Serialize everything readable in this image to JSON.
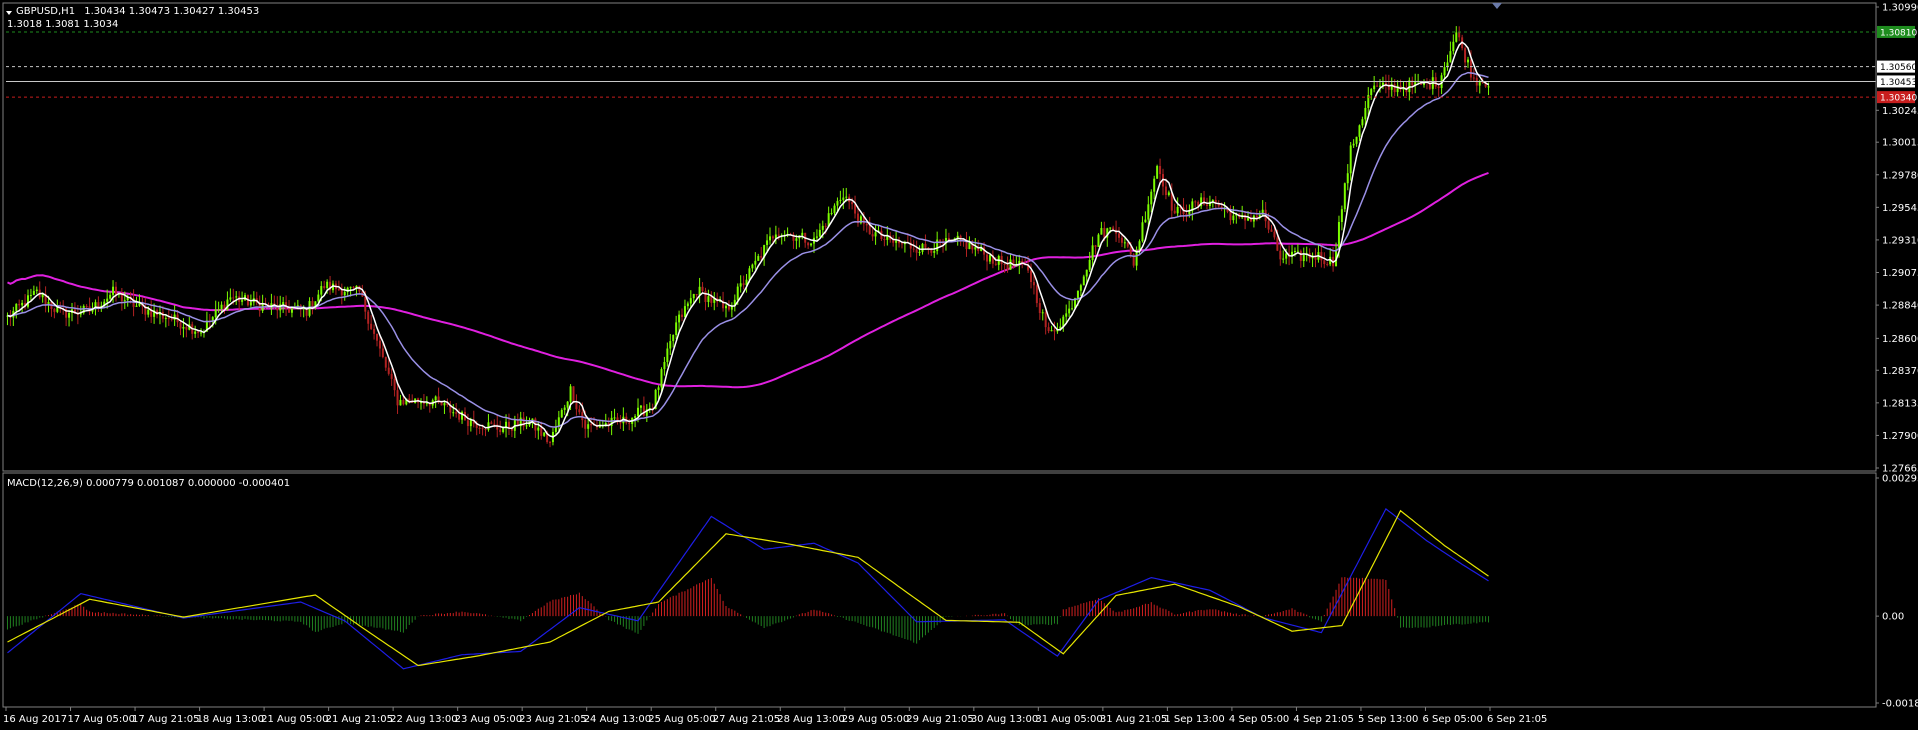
{
  "window": {
    "title": "GBPUSD,H1",
    "ohlc": "1.30434 1.30473 1.30427 1.30453",
    "levels_line": "1.3018 1.3081 1.3034"
  },
  "colors": {
    "background": "#000000",
    "frame": "#808080",
    "bull_candle": "#7CFC00",
    "bear_candle": "#B22222",
    "ma_fast": "#FFFFFF",
    "ma_mid": "#9A90E6",
    "ma_slow": "#E020E0",
    "macd_line": "#1E1EE6",
    "signal_line": "#E6E600",
    "hist_pos": "#D22020",
    "hist_neg": "#208020",
    "level_green": "#1E8C1E",
    "level_white": "#FFFFFF",
    "level_red": "#C81E1E"
  },
  "icons": {
    "menu_arrow": "triangle-down-icon",
    "shift_marker": "triangle-down-icon"
  },
  "price_axis": {
    "ticks": [
      "1.30990",
      "1.30560",
      "1.30453",
      "1.30245",
      "1.30015",
      "1.29780",
      "1.29545",
      "1.29310",
      "1.29075",
      "1.28840",
      "1.28600",
      "1.28370",
      "1.28135",
      "1.27900",
      "1.27665"
    ],
    "grid_ticks": [
      1.3099,
      1.30245,
      1.30015,
      1.2978,
      1.29545,
      1.2931,
      1.29075,
      1.2884,
      1.286,
      1.2837,
      1.28135,
      1.279,
      1.27665
    ],
    "range": [
      1.27665,
      1.3099
    ]
  },
  "price_tags": [
    {
      "label": "1.30810",
      "value": 1.3081,
      "color": "#1E8C1E",
      "text_color": "#FFFFFF",
      "line_style": "dashed"
    },
    {
      "label": "1.30560",
      "value": 1.3056,
      "color": "#FFFFFF",
      "text_color": "#000000",
      "line_style": "dashed"
    },
    {
      "label": "1.30453",
      "value": 1.30453,
      "color": "#FFFFFF",
      "text_color": "#000000",
      "line_style": "solid"
    },
    {
      "label": "1.30340",
      "value": 1.3034,
      "color": "#C81E1E",
      "text_color": "#FFFFFF",
      "line_style": "dashed"
    }
  ],
  "macd_panel": {
    "title": "MACD(12,26,9) 0.000779 0.001087 0.000000 -0.000401",
    "axis_ticks": [
      {
        "label": "0.002936",
        "value": 0.002936
      },
      {
        "label": "0.00",
        "value": 0.0
      },
      {
        "label": "-0.001846",
        "value": -0.001846
      }
    ]
  },
  "time_axis": {
    "labels": [
      "16 Aug 2017",
      "17 Aug 05:00",
      "17 Aug 21:05",
      "18 Aug 13:00",
      "21 Aug 05:00",
      "21 Aug 21:05",
      "22 Aug 13:00",
      "23 Aug 05:00",
      "23 Aug 21:05",
      "24 Aug 13:00",
      "25 Aug 05:00",
      "27 Aug 21:05",
      "28 Aug 13:00",
      "29 Aug 05:00",
      "29 Aug 21:05",
      "30 Aug 13:00",
      "31 Aug 05:00",
      "31 Aug 21:05",
      "1 Sep 13:00",
      "4 Sep 05:00",
      "4 Sep 21:05",
      "5 Sep 13:00",
      "6 Sep 05:00",
      "6 Sep 21:05"
    ]
  },
  "chart_data": [
    {
      "type": "candlestick",
      "title": "GBPUSD,H1",
      "x_start": "16 Aug 2017",
      "x_end": "6 Sep 21:05",
      "ylim": [
        1.27665,
        1.3099
      ],
      "price_anchors": [
        {
          "t": 0,
          "p": 1.2875
        },
        {
          "t": 10,
          "p": 1.2893
        },
        {
          "t": 18,
          "p": 1.2878
        },
        {
          "t": 28,
          "p": 1.288
        },
        {
          "t": 36,
          "p": 1.2893
        },
        {
          "t": 45,
          "p": 1.2882
        },
        {
          "t": 55,
          "p": 1.2875
        },
        {
          "t": 66,
          "p": 1.2865
        },
        {
          "t": 76,
          "p": 1.289
        },
        {
          "t": 88,
          "p": 1.2883
        },
        {
          "t": 102,
          "p": 1.288
        },
        {
          "t": 108,
          "p": 1.2898
        },
        {
          "t": 120,
          "p": 1.2893
        },
        {
          "t": 128,
          "p": 1.2845
        },
        {
          "t": 133,
          "p": 1.2815
        },
        {
          "t": 145,
          "p": 1.2815
        },
        {
          "t": 158,
          "p": 1.28
        },
        {
          "t": 168,
          "p": 1.2795
        },
        {
          "t": 178,
          "p": 1.28
        },
        {
          "t": 185,
          "p": 1.2785
        },
        {
          "t": 192,
          "p": 1.2823
        },
        {
          "t": 197,
          "p": 1.2796
        },
        {
          "t": 210,
          "p": 1.28
        },
        {
          "t": 220,
          "p": 1.2812
        },
        {
          "t": 228,
          "p": 1.287
        },
        {
          "t": 235,
          "p": 1.2895
        },
        {
          "t": 245,
          "p": 1.288
        },
        {
          "t": 262,
          "p": 1.2938
        },
        {
          "t": 275,
          "p": 1.293
        },
        {
          "t": 285,
          "p": 1.2965
        },
        {
          "t": 292,
          "p": 1.294
        },
        {
          "t": 300,
          "p": 1.293
        },
        {
          "t": 312,
          "p": 1.2925
        },
        {
          "t": 325,
          "p": 1.293
        },
        {
          "t": 338,
          "p": 1.2915
        },
        {
          "t": 348,
          "p": 1.291
        },
        {
          "t": 355,
          "p": 1.2862
        },
        {
          "t": 362,
          "p": 1.288
        },
        {
          "t": 372,
          "p": 1.2935
        },
        {
          "t": 378,
          "p": 1.294
        },
        {
          "t": 384,
          "p": 1.2915
        },
        {
          "t": 392,
          "p": 1.2985
        },
        {
          "t": 398,
          "p": 1.295
        },
        {
          "t": 410,
          "p": 1.296
        },
        {
          "t": 420,
          "p": 1.2945
        },
        {
          "t": 428,
          "p": 1.295
        },
        {
          "t": 434,
          "p": 1.2918
        },
        {
          "t": 446,
          "p": 1.292
        },
        {
          "t": 452,
          "p": 1.2915
        },
        {
          "t": 458,
          "p": 1.2995
        },
        {
          "t": 465,
          "p": 1.304
        },
        {
          "t": 478,
          "p": 1.3042
        },
        {
          "t": 488,
          "p": 1.3045
        },
        {
          "t": 494,
          "p": 1.308
        },
        {
          "t": 500,
          "p": 1.3047
        },
        {
          "t": 505,
          "p": 1.3045
        }
      ]
    },
    {
      "type": "line",
      "title": "MACD(12,26,9)",
      "ylim": [
        -0.001846,
        0.002936
      ],
      "series": [
        {
          "name": "MACD",
          "color": "#1E1EE6",
          "points": [
            {
              "t": 0,
              "v": -0.00078
            },
            {
              "t": 25,
              "v": 0.00048
            },
            {
              "t": 60,
              "v": -4e-05
            },
            {
              "t": 100,
              "v": 0.0003
            },
            {
              "t": 115,
              "v": -0.0001
            },
            {
              "t": 135,
              "v": -0.00112
            },
            {
              "t": 155,
              "v": -0.00082
            },
            {
              "t": 175,
              "v": -0.00075
            },
            {
              "t": 195,
              "v": 0.00018
            },
            {
              "t": 215,
              "v": -0.0001
            },
            {
              "t": 240,
              "v": 0.00212
            },
            {
              "t": 258,
              "v": 0.00142
            },
            {
              "t": 275,
              "v": 0.00155
            },
            {
              "t": 290,
              "v": 0.00113
            },
            {
              "t": 310,
              "v": -0.00012
            },
            {
              "t": 340,
              "v": -8e-05
            },
            {
              "t": 358,
              "v": -0.00085
            },
            {
              "t": 372,
              "v": 0.00034
            },
            {
              "t": 390,
              "v": 0.00082
            },
            {
              "t": 410,
              "v": 0.00055
            },
            {
              "t": 428,
              "v": -3e-05
            },
            {
              "t": 448,
              "v": -0.00035
            },
            {
              "t": 470,
              "v": 0.00228
            },
            {
              "t": 484,
              "v": 0.0016
            },
            {
              "t": 496,
              "v": 0.0011
            },
            {
              "t": 505,
              "v": 0.00075
            }
          ]
        },
        {
          "name": "Signal",
          "color": "#E6E600",
          "points": [
            {
              "t": 0,
              "v": -0.00055
            },
            {
              "t": 28,
              "v": 0.00036
            },
            {
              "t": 60,
              "v": -2e-05
            },
            {
              "t": 105,
              "v": 0.00045
            },
            {
              "t": 120,
              "v": -0.0002
            },
            {
              "t": 140,
              "v": -0.00105
            },
            {
              "t": 160,
              "v": -0.00085
            },
            {
              "t": 185,
              "v": -0.00055
            },
            {
              "t": 205,
              "v": 0.0001
            },
            {
              "t": 222,
              "v": 0.0003
            },
            {
              "t": 245,
              "v": 0.00175
            },
            {
              "t": 265,
              "v": 0.00155
            },
            {
              "t": 290,
              "v": 0.00125
            },
            {
              "t": 320,
              "v": -9e-05
            },
            {
              "t": 345,
              "v": -0.00013
            },
            {
              "t": 360,
              "v": -0.0008
            },
            {
              "t": 378,
              "v": 0.00044
            },
            {
              "t": 398,
              "v": 0.00068
            },
            {
              "t": 420,
              "v": 0.0002
            },
            {
              "t": 438,
              "v": -0.00032
            },
            {
              "t": 455,
              "v": -0.0002
            },
            {
              "t": 475,
              "v": 0.00224
            },
            {
              "t": 490,
              "v": 0.0015
            },
            {
              "t": 505,
              "v": 0.00085
            }
          ]
        }
      ]
    }
  ]
}
